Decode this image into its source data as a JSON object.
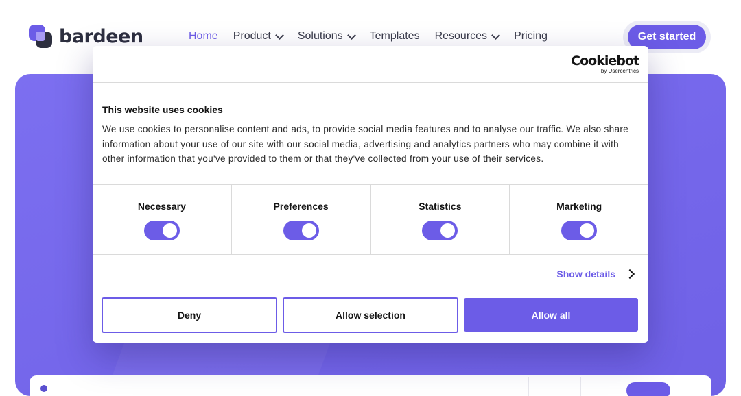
{
  "site": {
    "logo_text": "bardeen",
    "nav": [
      {
        "label": "Home"
      },
      {
        "label": "Product"
      },
      {
        "label": "Solutions"
      },
      {
        "label": "Templates"
      },
      {
        "label": "Resources"
      },
      {
        "label": "Pricing"
      }
    ],
    "cta_label": "Get started"
  },
  "cookie": {
    "brand": "Cookiebot",
    "brand_sub": "by Usercentrics",
    "title": "This website uses cookies",
    "body": "We use cookies to personalise content and ads, to provide social media features and to analyse our traffic. We also share information about your use of our site with our social media, advertising and analytics partners who may combine it with other information that you've provided to them or that they've collected from your use of their services.",
    "categories": [
      {
        "label": "Necessary",
        "enabled": true
      },
      {
        "label": "Preferences",
        "enabled": true
      },
      {
        "label": "Statistics",
        "enabled": true
      },
      {
        "label": "Marketing",
        "enabled": true
      }
    ],
    "show_details": "Show details",
    "buttons": {
      "deny": "Deny",
      "allow_selection": "Allow selection",
      "allow_all": "Allow all"
    }
  },
  "colors": {
    "accent": "#6c5ce7",
    "hero": "#7466ea"
  }
}
